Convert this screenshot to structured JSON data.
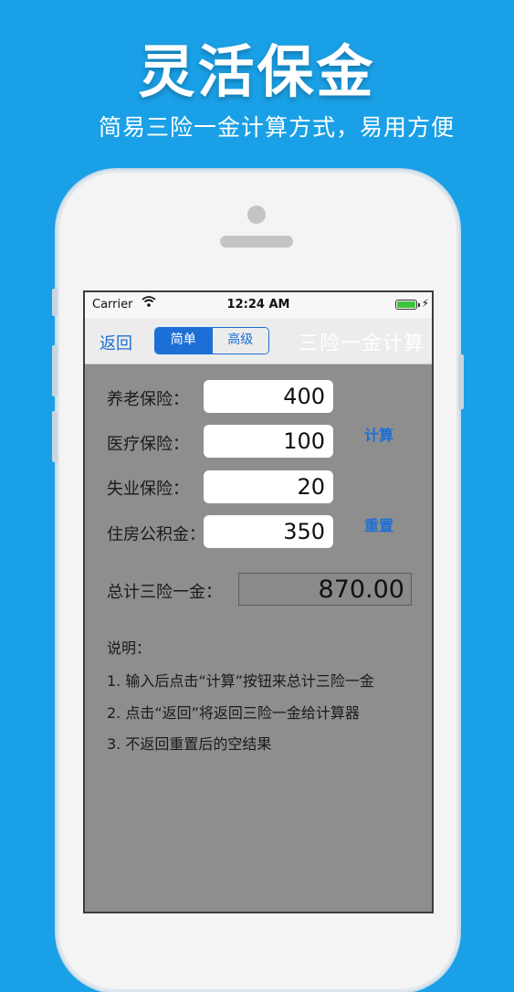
{
  "banner": {
    "title": "灵活保金",
    "subtitle": "简易三险一金计算方式，易用方便"
  },
  "status": {
    "carrier": "Carrier",
    "wifi_icon": "wifi-icon",
    "time": "12:24 AM",
    "battery_icon": "battery-icon"
  },
  "nav": {
    "back_label": "返回",
    "segments": [
      "简单",
      "高级"
    ],
    "selected_segment": "简单",
    "title": "三险一金计算"
  },
  "form": {
    "rows": [
      {
        "label": "养老保险：",
        "value": "400"
      },
      {
        "label": "医疗保险：",
        "value": "100"
      },
      {
        "label": "失业保险：",
        "value": "20"
      },
      {
        "label": "住房公积金：",
        "value": "350"
      }
    ],
    "calc_label": "计算",
    "reset_label": "重置",
    "total_label": "总计三险一金：",
    "total_value": "870.00"
  },
  "notes": {
    "heading": "说明：",
    "lines": [
      "1. 输入后点击“计算”按钮来总计三险一金",
      "2. 点击“返回”将返回三险一金给计算器",
      "3. 不返回重置后的空结果"
    ]
  },
  "colors": {
    "background": "#1aa0e6",
    "accent": "#1c6fd6",
    "screen": "#8e8e8e"
  }
}
